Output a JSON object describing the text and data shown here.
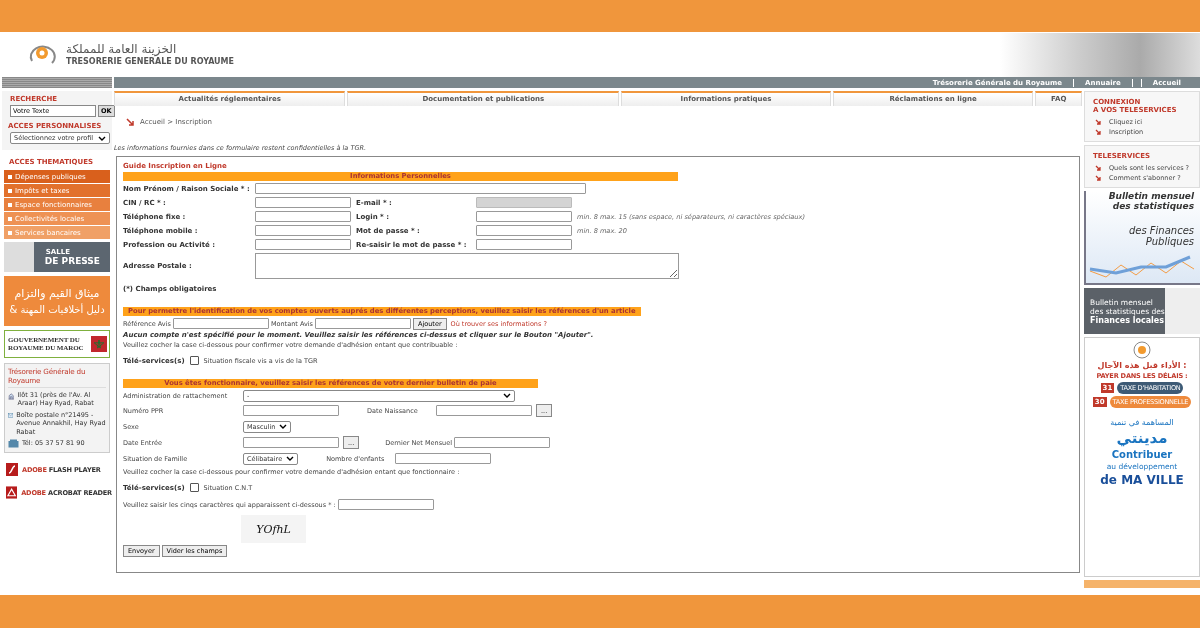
{
  "header": {
    "logo_arabic": "الخزينة العامة للمملكة",
    "logo_text": "TRESORERIE GENERALE DU ROYAUME"
  },
  "top_links": [
    "Trésorerie Générale du Royaume",
    "Annuaire",
    "Accueil"
  ],
  "search": {
    "title": "RECHERCHE",
    "value": "Votre Texte",
    "button": "OK"
  },
  "profile": {
    "title": "ACCES PERSONNALISES",
    "value": "Sélectionnez votre profil"
  },
  "thematic": {
    "title": "ACCES THEMATIQUES",
    "items": [
      {
        "label": "Dépenses publiques",
        "color": "#d9601c"
      },
      {
        "label": "Impôts et taxes",
        "color": "#e2712c"
      },
      {
        "label": "Espace fonctionnaires",
        "color": "#e8803e"
      },
      {
        "label": "Collectivités locales",
        "color": "#ee9254"
      },
      {
        "label": "Services bancaires",
        "color": "#f0a066"
      }
    ]
  },
  "press_banner": {
    "line1": "SALLE",
    "line2": "DE PRESSE"
  },
  "ethics_banner": {
    "line1": "ميثاق القيم والتزام",
    "symbol": "&",
    "line2": "دليل أخلاقيات المهنة"
  },
  "gov_banner": {
    "line1": "GOUVERNEMENT DU",
    "line2": "ROYAUME DU MAROC"
  },
  "contact": {
    "title": "Trésorerie Générale du Royaume",
    "items": [
      {
        "kind": "address",
        "text": "Ilôt 31 (près de l'Av. Al Araar) Hay Ryad, Rabat"
      },
      {
        "kind": "mail",
        "text": "Boîte postale n°21495 - Avenue Annakhil, Hay Ryad Rabat"
      },
      {
        "kind": "phone",
        "text": "Tél: 05 37 57 81 90"
      }
    ]
  },
  "downloads": [
    {
      "kind": "flash",
      "brand": "ADOBE",
      "name": "FLASH PLAYER"
    },
    {
      "kind": "acrobat",
      "brand": "ADOBE",
      "name": "ACROBAT READER"
    }
  ],
  "nav_tabs": [
    "Actualités réglementaires",
    "Documentation et publications",
    "Informations pratiques",
    "Réclamations en ligne",
    "FAQ"
  ],
  "breadcrumb": "Accueil > Inscription",
  "notice": "Les informations fournies dans ce formulaire restent confidentielles à la TGR.",
  "form": {
    "guide": "Guide Inscription en Ligne",
    "personal": {
      "title": "Informations Personnelles",
      "name_label": "Nom Prénom / Raison Sociale * :",
      "rows": [
        {
          "left": "CIN / RC * :",
          "right": "E-mail * :",
          "right_disabled": true
        },
        {
          "left": "Téléphone fixe :",
          "right": "Login * :",
          "right_disabled": false,
          "hint": "min. 8 max. 15 (sans espace, ni séparateurs, ni caractères spéciaux)"
        },
        {
          "left": "Téléphone mobile :",
          "right": "Mot de passe * :",
          "right_disabled": false,
          "hint": "min. 8 max. 20"
        },
        {
          "left": "Profession ou Activité :",
          "right": "Re-saisir le mot de passe * :",
          "right_disabled": false
        }
      ],
      "address_label": "Adresse Postale :",
      "required_note": "(*) Champs obligatoires"
    },
    "accounts": {
      "title": "Pour permettre l'identification de vos comptes ouverts auprés des différentes perceptions, veuillez saisir les références d'un article",
      "ref_label": "Référence Avis",
      "amount_label": "Montant Avis",
      "add_button": "Ajouter",
      "help_link": "Où trouver ses informations ?",
      "empty_message": "Aucun compte n'est spécifié pour le moment. Veuillez saisir les références ci-dessus et cliquer sur le Bouton \"Ajouter\".",
      "confirm_text": "Veuillez cocher la case ci-dessous pour confirmer votre demande d'adhésion entant que contribuable :",
      "teleservices_label": "Télé-services(s)",
      "checkbox": {
        "label": "Situation fiscale vis a vis de la TGR",
        "checked": false
      }
    },
    "civil_servant": {
      "title": "Vous êtes fonctionnaire, veuillez saisir les références de votre dernier bulletin de paie",
      "administration_label": "Administration de rattachement",
      "administration_value": "-",
      "rows": [
        {
          "left": {
            "label": "Numéro PPR",
            "kind": "text"
          },
          "right": {
            "label": "Date Naissance",
            "kind": "date"
          }
        },
        {
          "left": {
            "label": "Sexe",
            "kind": "select",
            "value": "Masculin"
          }
        },
        {
          "left": {
            "label": "Date Entrée",
            "kind": "date"
          },
          "right": {
            "label": "Dernier Net Mensuel",
            "kind": "text"
          }
        },
        {
          "left": {
            "label": "Situation de Famille",
            "kind": "select",
            "value": "Célibataire"
          },
          "right": {
            "label": "Nombre d'enfants",
            "kind": "text"
          }
        }
      ],
      "date_button": "...",
      "confirm_text": "Veuillez cocher la case ci-dessous pour confirmer votre demande d'adhésion entant que fonctionnaire :",
      "teleservices_label": "Télé-services(s)",
      "checkbox": {
        "label": "Situation C.N.T",
        "checked": false
      }
    },
    "captcha": {
      "label": "Veuillez saisir les cinqs caractères qui apparaissent ci-dessous * :",
      "image_text": "YOfhL"
    },
    "buttons": [
      "Envoyer",
      "Vider les champs"
    ]
  },
  "connexion": {
    "title": "CONNEXION",
    "subtitle": "A VOS TELESERVICES",
    "links": [
      "Cliquez ici",
      "Inscription"
    ]
  },
  "teleservices": {
    "title": "TELESERVICES",
    "links": [
      "Quels sont les services ?",
      "Comment s'abonner ?"
    ]
  },
  "stats_banner": {
    "line1": "Bulletin mensuel",
    "line2": "des statistiques",
    "line3": "des Finances",
    "line4": "Publiques"
  },
  "local_banner": {
    "line1": "Bulletin mensuel",
    "line2": "des statistiques des",
    "line3": "Finances locales"
  },
  "deadline_ad": {
    "arabic_title": "الأداء قبل هذه الآجال :",
    "title": "PAYER DANS LES DÉLAIS :",
    "items": [
      {
        "day": "31",
        "label": "TAXE D'HABITATION"
      },
      {
        "day": "30",
        "label": "TAXE PROFESSIONNELLE"
      }
    ],
    "arabic_city": "المساهمة في تنمية",
    "arabic_name": "مدينتي",
    "line1": "Contribuer",
    "line2": "au développement",
    "line3": "de MA VILLE"
  }
}
